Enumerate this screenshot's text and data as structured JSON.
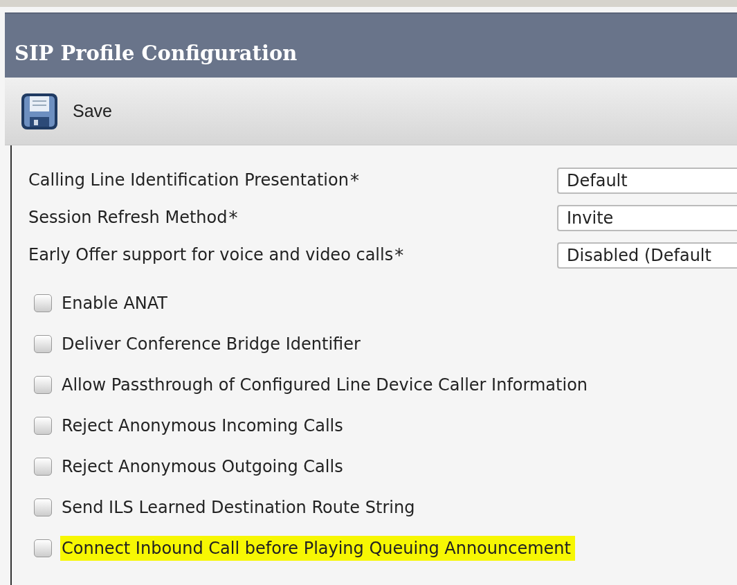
{
  "window": {
    "title": "SIP Profile Configuration"
  },
  "toolbar": {
    "buttons": [
      {
        "label": "Save",
        "kind": "save"
      }
    ]
  },
  "fields": [
    {
      "label": "Calling Line Identification Presentation",
      "required_mark": "*",
      "value": "Default"
    },
    {
      "label": "Session Refresh Method",
      "required_mark": "*",
      "value": "Invite"
    },
    {
      "label": "Early Offer support for voice and video calls",
      "required_mark": "*",
      "value": "Disabled (Default"
    }
  ],
  "options": [
    {
      "label": "Enable ANAT",
      "checked": false,
      "highlighted": false
    },
    {
      "label": "Deliver Conference Bridge Identifier",
      "checked": false,
      "highlighted": false
    },
    {
      "label": "Allow Passthrough of Configured Line Device Caller Information",
      "checked": false,
      "highlighted": false
    },
    {
      "label": "Reject Anonymous Incoming Calls",
      "checked": false,
      "highlighted": false
    },
    {
      "label": "Reject Anonymous Outgoing Calls",
      "checked": false,
      "highlighted": false
    },
    {
      "label": "Send ILS Learned Destination Route String",
      "checked": false,
      "highlighted": false
    },
    {
      "label": "Connect Inbound Call before Playing Queuing Announcement",
      "checked": false,
      "highlighted": true
    }
  ]
}
